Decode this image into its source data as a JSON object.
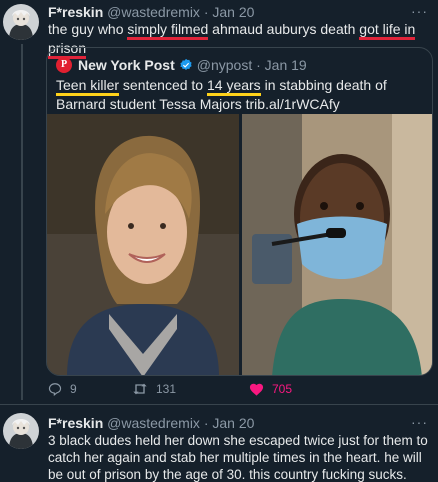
{
  "tweet1": {
    "name": "F*reskin",
    "handle": "@wastedremix",
    "date": "Jan 20",
    "text_parts": [
      "the guy who ",
      "simply filmed",
      " ahmaud auburys death ",
      "got life in prison"
    ],
    "more": "···",
    "quote": {
      "logo_letter": "P",
      "name": "New York Post",
      "handle": "@nypost",
      "date": "Jan 19",
      "text_parts": [
        "Teen killer",
        " sentenced to ",
        "14 years",
        " in stabbing death of Barnard student Tessa Majors trib.al/1rWCAfy"
      ]
    },
    "actions": {
      "replies": "9",
      "retweets": "131",
      "likes": "705"
    }
  },
  "tweet2": {
    "name": "F*reskin",
    "handle": "@wastedremix",
    "date": "Jan 20",
    "more": "···",
    "text": "3 black dudes held her down she escaped twice just for them to catch her again and stab her multiple times in the heart. he will be out of prison by the age of 30. this country fucking sucks."
  },
  "colors": {
    "background": "#15202b",
    "text": "#e7e9ea",
    "muted": "#8b98a5",
    "like": "#f91880",
    "underline_red": "#e0243a",
    "underline_yellow": "#ffd21a"
  },
  "icons": [
    "reply-icon",
    "retweet-icon",
    "heart-icon",
    "verified-icon",
    "more-icon"
  ]
}
